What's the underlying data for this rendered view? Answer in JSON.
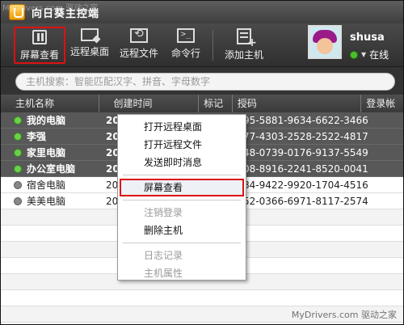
{
  "window": {
    "title": "向日葵主控端",
    "watermark_top": "MyDrivers.com 驱动之家"
  },
  "toolbar": {
    "items": [
      {
        "label": "屏幕查看"
      },
      {
        "label": "远程桌面"
      },
      {
        "label": "远程文件"
      },
      {
        "label": "命令行"
      },
      {
        "label": "添加主机"
      }
    ]
  },
  "user": {
    "name": "shusa",
    "status": "在线"
  },
  "search": {
    "placeholder": "主机搜索：智能匹配汉字、拼音、字母数字"
  },
  "table": {
    "columns": [
      "主机名称",
      "创建时间",
      "标记",
      "授码",
      "登录帐"
    ],
    "rows": [
      {
        "name": "我的电脑",
        "created": "20",
        "code": "95-5881-9634-6622-3466",
        "online": true
      },
      {
        "name": "李强",
        "created": "20",
        "code": "77-4303-2528-2522-4817",
        "online": true
      },
      {
        "name": "家里电脑",
        "created": "20",
        "code": "48-0739-0176-9137-5549",
        "online": true
      },
      {
        "name": "办公室电脑",
        "created": "20",
        "code": "08-8916-2241-8520-0041",
        "online": true
      },
      {
        "name": "宿舍电脑",
        "created": "20",
        "code": "84-9422-9920-1704-4516",
        "online": false
      },
      {
        "name": "美美电脑",
        "created": "20",
        "code": "52-0366-6971-8117-2574",
        "online": false
      }
    ]
  },
  "context_menu": {
    "items": [
      {
        "label": "打开远程桌面"
      },
      {
        "label": "打开远程文件"
      },
      {
        "label": "发送即时消息"
      },
      {
        "label": "屏幕查看"
      },
      {
        "label": "注销登录"
      },
      {
        "label": "删除主机"
      },
      {
        "label": "日志记录"
      },
      {
        "label": "主机属性"
      }
    ]
  },
  "watermark_bottom": "MyDrivers.com 驱动之家"
}
